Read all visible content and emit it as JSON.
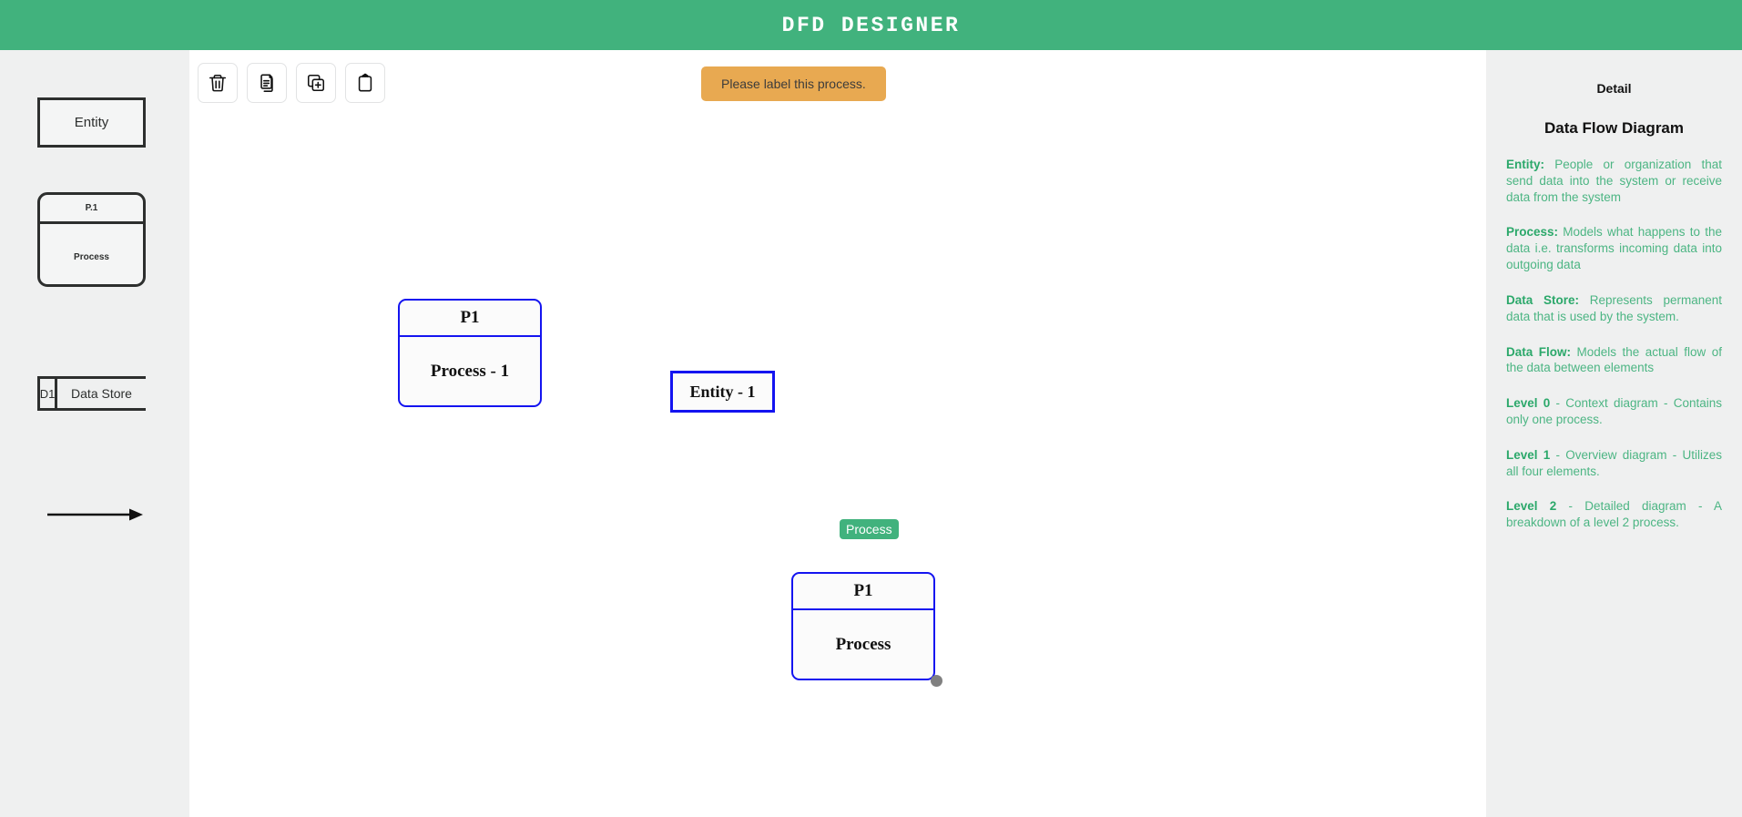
{
  "header": {
    "title": "DFD DESIGNER",
    "bg_color": "#41b27d"
  },
  "palette": {
    "entity": {
      "label": "Entity"
    },
    "process": {
      "id_label": "P.1",
      "label": "Process"
    },
    "data_store": {
      "id_label": "D1",
      "label": "Data Store"
    },
    "data_flow": {
      "name": "data-flow-arrow"
    }
  },
  "toolbar": {
    "buttons": [
      {
        "name": "delete-button",
        "icon": "trash-icon"
      },
      {
        "name": "copy-button",
        "icon": "document-copy-icon"
      },
      {
        "name": "duplicate-button",
        "icon": "add-square-icon"
      },
      {
        "name": "paste-button",
        "icon": "clipboard-icon"
      }
    ]
  },
  "toast": {
    "message": "Please label this process.",
    "bg_color": "#e8a951"
  },
  "canvas": {
    "nodes": [
      {
        "type": "process",
        "id_label": "P1",
        "label": "Process - 1",
        "selected": false
      },
      {
        "type": "entity",
        "label": "Entity - 1",
        "selected": false
      },
      {
        "type": "process",
        "id_label": "P1",
        "label": "Process",
        "badge": "Process",
        "selected": true
      }
    ],
    "border_color": "#1414f0",
    "badge_color": "#41b27d"
  },
  "detail": {
    "heading": "Detail",
    "subheading": "Data Flow Diagram",
    "text_color": "#4cb583",
    "items": [
      {
        "term": "Entity:",
        "description": "People or organization that send data into the system or receive data from the system"
      },
      {
        "term": "Process:",
        "description": "Models what happens to the data i.e. transforms incoming data into outgoing data"
      },
      {
        "term": "Data Store:",
        "description": "Represents permanent data that is used by the system."
      },
      {
        "term": "Data Flow:",
        "description": "Models the actual flow of the data between elements"
      },
      {
        "term": "Level 0",
        "description": "- Context diagram - Contains only one process."
      },
      {
        "term": "Level 1",
        "description": "- Overview diagram - Utilizes all four elements."
      },
      {
        "term": "Level 2",
        "description": "- Detailed diagram - A breakdown of a level 2 process."
      }
    ]
  }
}
